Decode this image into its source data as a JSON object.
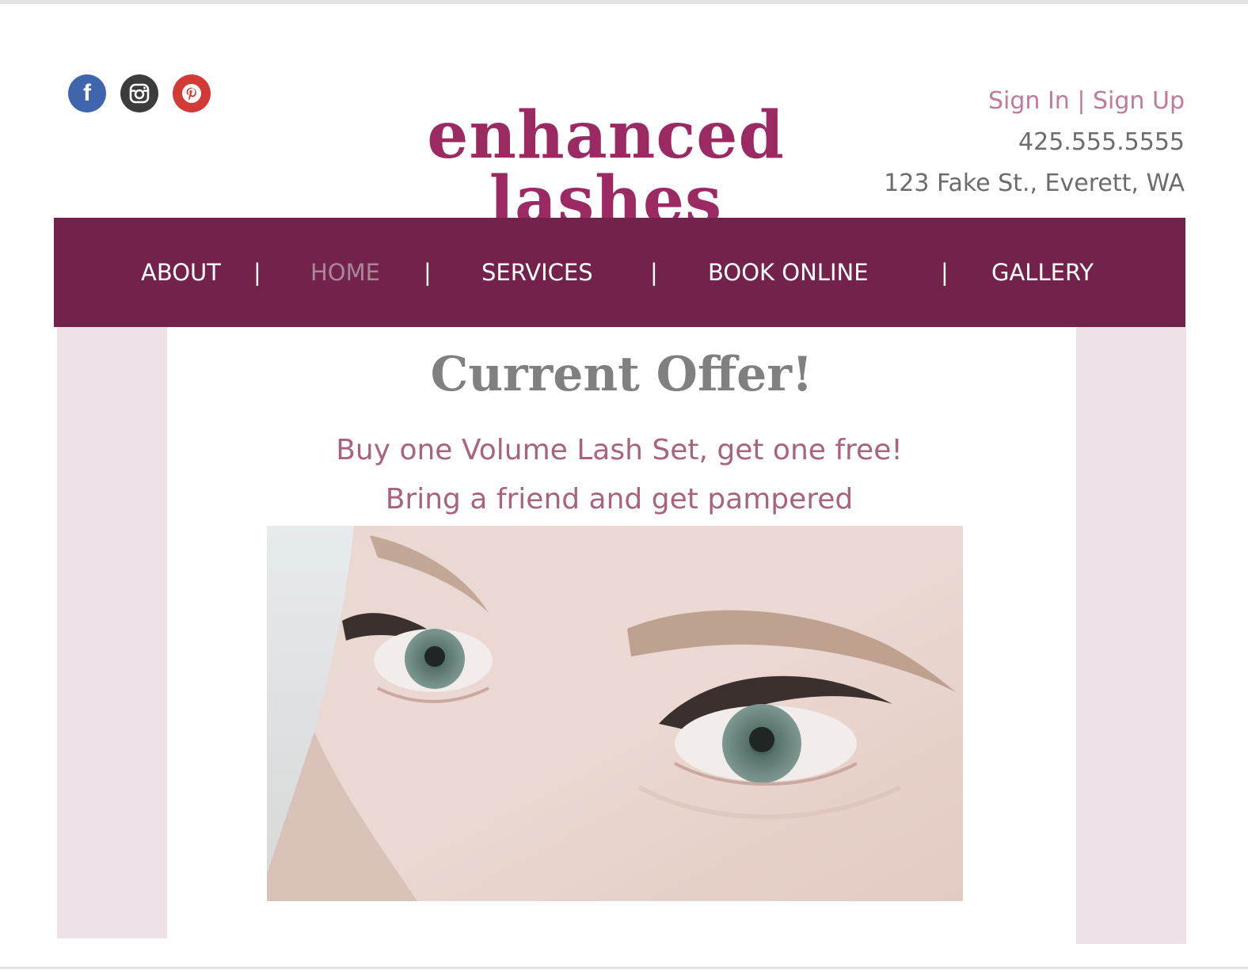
{
  "social": [
    {
      "name": "facebook-icon",
      "glyph": "f"
    },
    {
      "name": "instagram-icon",
      "glyph": ""
    },
    {
      "name": "pinterest-icon",
      "glyph": "p"
    }
  ],
  "logo": "enhanced lashes",
  "contact": {
    "sign_in": "Sign In",
    "divider": "|",
    "sign_up": "Sign Up",
    "phone": "425.555.5555",
    "address": "123 Fake St., Everett, WA"
  },
  "nav": {
    "items": [
      {
        "label": "ABOUT",
        "active": false
      },
      {
        "label": "HOME",
        "active": true
      },
      {
        "label": "SERVICES",
        "active": false
      },
      {
        "label": "BOOK ONLINE",
        "active": false
      },
      {
        "label": "GALLERY",
        "active": false
      }
    ],
    "separator": "|"
  },
  "offer": {
    "title": "Current Offer!",
    "line1": "Buy one Volume Lash Set, get one free!",
    "line2": "Bring a friend and get pampered"
  },
  "colors": {
    "brand": "#9b2a63",
    "nav_bg": "#72224b",
    "side_panel": "#efe1e8",
    "offer_text": "#a8637f"
  }
}
